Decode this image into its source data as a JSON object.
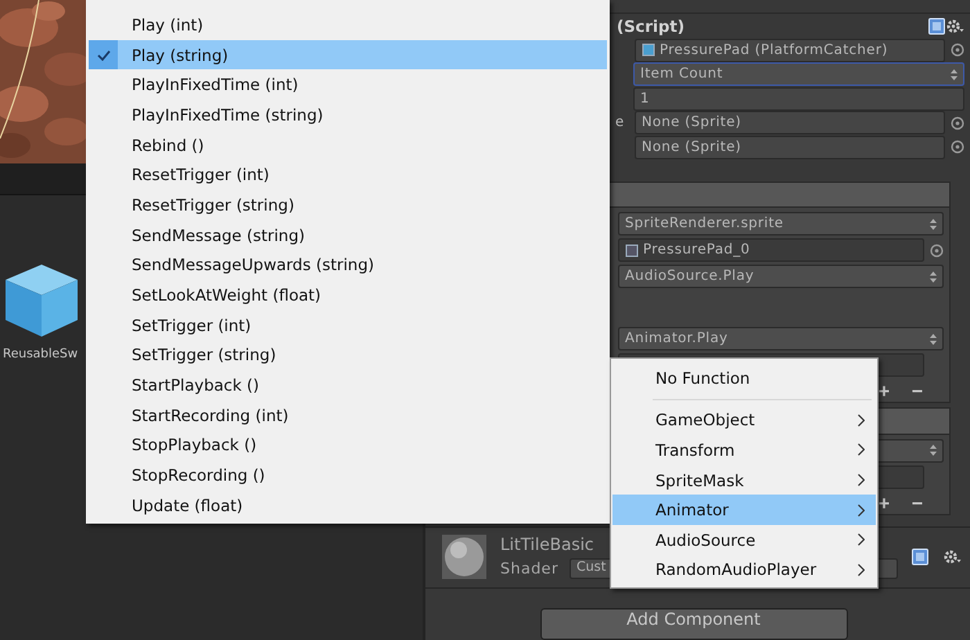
{
  "project_panel": {
    "asset_name": "ReusableSw"
  },
  "inspector": {
    "script_component": {
      "title": "(Script)",
      "target": "PressurePad (PlatformCatcher)",
      "method": "Item Count",
      "method_focused": true,
      "value": "1",
      "label_fragment": "e",
      "sprite_fields": [
        "None (Sprite)",
        "None (Sprite)"
      ]
    },
    "event_lists": [
      {
        "entries": [
          {
            "kind": "argument",
            "function": "SpriteRenderer.sprite",
            "argument": "PressurePad_0"
          },
          {
            "kind": "plain",
            "function": "AudioSource.Play"
          },
          {
            "kind": "argument",
            "function": "Animator.Play"
          }
        ],
        "buttons": [
          "+",
          "−"
        ]
      },
      {
        "entries": [
          {
            "kind": "argument"
          }
        ],
        "buttons": [
          "+",
          "−"
        ]
      }
    ],
    "material": {
      "name": "LitTileBasic",
      "shader_label": "Shader",
      "shader": "Cust"
    },
    "add_component": "Add Component"
  },
  "function_menu": {
    "items": [
      {
        "label": "Play (int)",
        "selected": false
      },
      {
        "label": "Play (string)",
        "selected": true
      },
      {
        "label": "PlayInFixedTime (int)",
        "selected": false
      },
      {
        "label": "PlayInFixedTime (string)",
        "selected": false
      },
      {
        "label": "Rebind ()",
        "selected": false
      },
      {
        "label": "ResetTrigger (int)",
        "selected": false
      },
      {
        "label": "ResetTrigger (string)",
        "selected": false
      },
      {
        "label": "SendMessage (string)",
        "selected": false
      },
      {
        "label": "SendMessageUpwards (string)",
        "selected": false
      },
      {
        "label": "SetLookAtWeight (float)",
        "selected": false
      },
      {
        "label": "SetTrigger (int)",
        "selected": false
      },
      {
        "label": "SetTrigger (string)",
        "selected": false
      },
      {
        "label": "StartPlayback ()",
        "selected": false
      },
      {
        "label": "StartRecording (int)",
        "selected": false
      },
      {
        "label": "StopPlayback ()",
        "selected": false
      },
      {
        "label": "StopRecording ()",
        "selected": false
      },
      {
        "label": "Update (float)",
        "selected": false
      }
    ]
  },
  "component_menu": {
    "items": [
      {
        "kind": "none",
        "label": "No Function",
        "selected": false
      },
      {
        "kind": "component",
        "label": "GameObject",
        "selected": false
      },
      {
        "kind": "component",
        "label": "Transform",
        "selected": false
      },
      {
        "kind": "component",
        "label": "SpriteMask",
        "selected": false
      },
      {
        "kind": "component",
        "label": "Animator",
        "selected": true
      },
      {
        "kind": "component",
        "label": "AudioSource",
        "selected": false
      },
      {
        "kind": "component",
        "label": "RandomAudioPlayer",
        "selected": false
      }
    ]
  }
}
